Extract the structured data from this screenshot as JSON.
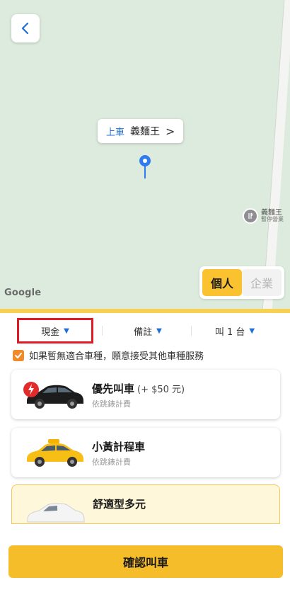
{
  "map": {
    "pickup_label": "上車",
    "pickup_name": "義麵王",
    "poi_name": "義麵王",
    "poi_status": "暫停營業",
    "attribution": "Google"
  },
  "mode": {
    "personal": "個人",
    "business": "企業",
    "selected": "personal"
  },
  "options": {
    "payment": "現金",
    "note": "備註",
    "count": "叫 1 台"
  },
  "accept_other": {
    "label": "如果暫無適合車種，願意接受其他車種服務",
    "checked": true
  },
  "services": [
    {
      "name": "優先叫車",
      "extra": "(+ $50 元)",
      "sub": "依跳錶計費"
    },
    {
      "name": "小黃計程車",
      "sub": "依跳錶計費"
    },
    {
      "name": "舒適型多元"
    }
  ],
  "confirm_label": "確認叫車",
  "colors": {
    "accent": "#f6bd2b",
    "link": "#1f6fd6",
    "highlight": "#e11b25",
    "checkbox": "#f08b2a"
  }
}
